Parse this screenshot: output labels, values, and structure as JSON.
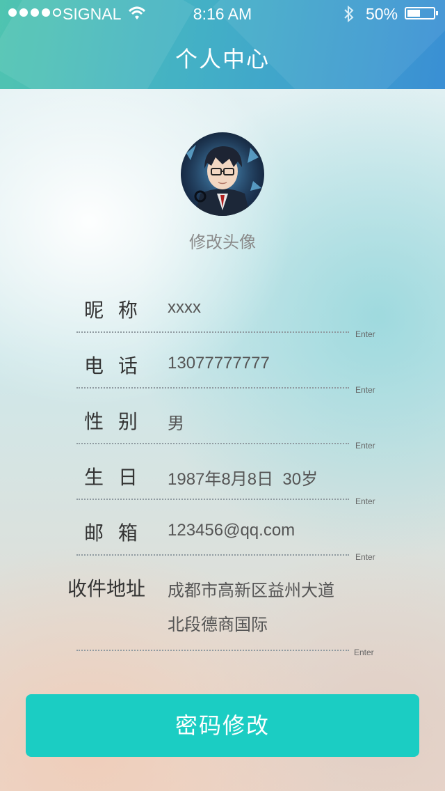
{
  "status_bar": {
    "carrier": "SIGNAL",
    "time": "8:16 AM",
    "battery": "50%",
    "battery_level": 0.5,
    "signal_strength": 4,
    "icons": [
      "wifi-icon",
      "bluetooth-icon",
      "battery-icon"
    ]
  },
  "header": {
    "title": "个人中心"
  },
  "profile": {
    "change_avatar": "修改头像"
  },
  "fields": [
    {
      "label": "昵 称",
      "value": "xxxx",
      "action": "Enter"
    },
    {
      "label": "电 话",
      "value": "13077777777",
      "action": "Enter"
    },
    {
      "label": "性 别",
      "value": "男",
      "action": "Enter"
    },
    {
      "label": "生 日",
      "value": "1987年8月8日  30岁",
      "action": "Enter"
    },
    {
      "label": "邮 箱",
      "value": "123456@qq.com",
      "action": "Enter"
    },
    {
      "label": "收件地址",
      "value_line1": "成都市高新区益州大道",
      "value_line2": "北段德商国际",
      "action": "Enter"
    }
  ],
  "buttons": {
    "change_password": "密码修改"
  },
  "colors": {
    "header_start": "#4fc4b0",
    "header_end": "#3a8fd4",
    "button": "#1bcdc3"
  }
}
